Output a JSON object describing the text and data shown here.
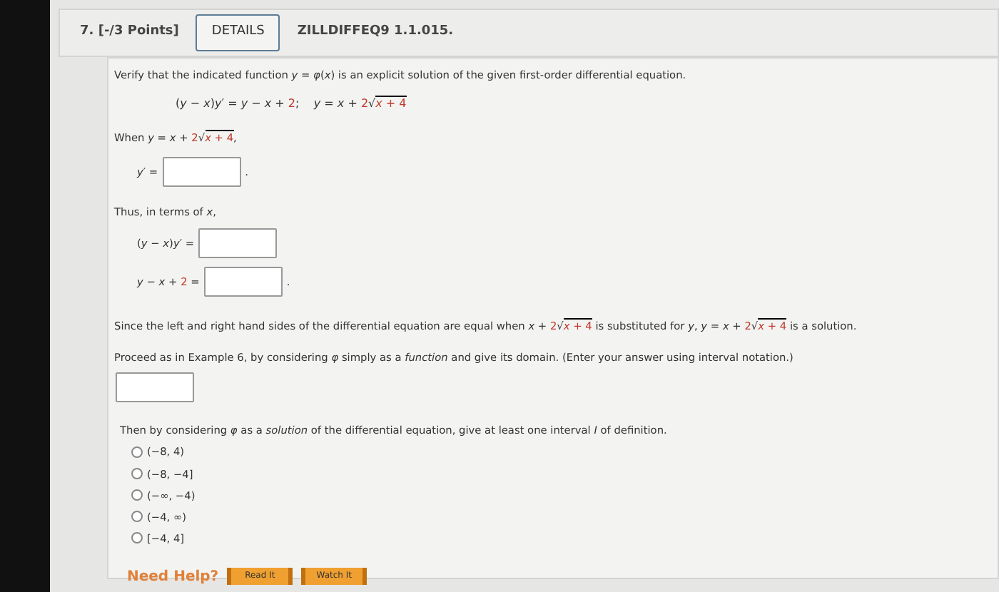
{
  "header": {
    "number": "7.",
    "points": "[-/3 Points]",
    "details_button": "DETAILS",
    "code": "ZILLDIFFEQ9 1.1.015."
  },
  "prompt": "Verify that the indicated function *y* = *φ*(*x*) is an explicit solution of the given first-order differential equation.",
  "equation": [
    {
      "kind": "text",
      "t": "(*y* − *x*)*y*′ = *y* − *x* + ",
      "red": false
    },
    {
      "kind": "text",
      "t": "2",
      "red": true
    },
    {
      "kind": "text",
      "t": ";    *y* = *x* + ",
      "red": false
    },
    {
      "kind": "text",
      "t": "2",
      "red": true
    },
    {
      "kind": "sqrt",
      "sign": "√",
      "t": "*x* + 4",
      "red": true
    }
  ],
  "when_line": [
    {
      "kind": "text",
      "t": "When *y* = *x* + ",
      "red": false
    },
    {
      "kind": "text",
      "t": "2",
      "red": true
    },
    {
      "kind": "sqrt",
      "sign": "√",
      "t": "*x* + 4",
      "red": true
    },
    {
      "kind": "text",
      "t": ",",
      "red": false
    }
  ],
  "derivative_row": {
    "label": [
      {
        "kind": "text",
        "t": "*y*′ =",
        "red": false
      }
    ],
    "after": "."
  },
  "thus_text": "Thus, in terms of *x*,",
  "rows": [
    {
      "label": [
        {
          "kind": "text",
          "t": "(*y* − *x*)*y*′ =",
          "red": false
        }
      ],
      "after": ""
    },
    {
      "label": [
        {
          "kind": "text",
          "t": "*y* − *x* + ",
          "red": false
        },
        {
          "kind": "text",
          "t": "2",
          "red": true
        },
        {
          "kind": "text",
          "t": " =",
          "red": false
        }
      ],
      "after": "."
    }
  ],
  "since_text": [
    {
      "kind": "text",
      "t": "Since the left and right hand sides of the differential equation are equal when *x* + ",
      "red": false
    },
    {
      "kind": "text",
      "t": "2",
      "red": true
    },
    {
      "kind": "sqrt",
      "sign": "√",
      "t": "*x* + 4",
      "red": true
    },
    {
      "kind": "text",
      "t": " is substituted for *y*, *y* = *x* + ",
      "red": false
    },
    {
      "kind": "text",
      "t": "2",
      "red": true
    },
    {
      "kind": "sqrt",
      "sign": "√",
      "t": "*x* + 4",
      "red": true
    },
    {
      "kind": "text",
      "t": " is a solution.",
      "red": false
    }
  ],
  "proceed_text": "Proceed as in Example 6, by considering *φ* simply as a *function* and give its domain. (Enter your answer using interval notation.)",
  "then_text": "Then by considering *φ* as a *solution* of the differential equation, give at least one interval *I* of definition.",
  "options": [
    {
      "label": "(−8, 4)",
      "selected": false
    },
    {
      "label": "(−8, −4]",
      "selected": false
    },
    {
      "label": "(−∞, −4)",
      "selected": false
    },
    {
      "label": "(−4, ∞)",
      "selected": false
    },
    {
      "label": "[−4, 4]",
      "selected": false
    }
  ],
  "help": {
    "label": "Need Help?",
    "buttons": [
      "Read It",
      "Watch It"
    ]
  }
}
